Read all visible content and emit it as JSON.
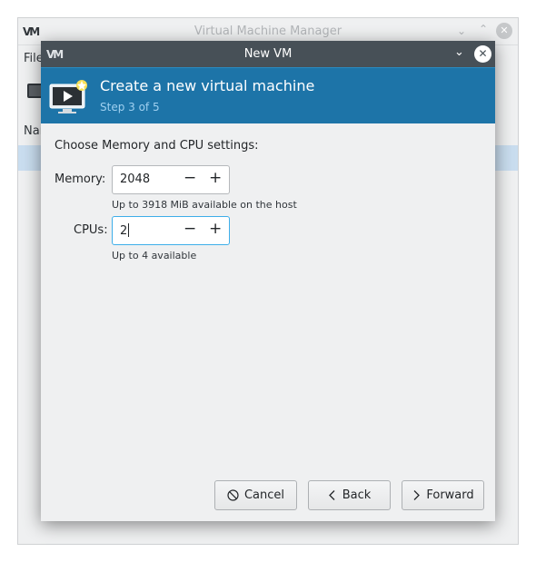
{
  "main_window": {
    "title": "Virtual Machine Manager",
    "logo": "VM",
    "menu_file": "File",
    "column_name": "Name"
  },
  "dialog": {
    "title": "New VM",
    "logo": "VM",
    "banner": {
      "title": "Create a new virtual machine",
      "step": "Step 3 of 5",
      "accent": "#1d74a8"
    },
    "section_label": "Choose Memory and CPU settings:",
    "memory": {
      "label": "Memory:",
      "value": "2048",
      "hint": "Up to 3918 MiB available on the host"
    },
    "cpus": {
      "label": "CPUs:",
      "value": "2",
      "hint": "Up to 4 available"
    },
    "buttons": {
      "cancel": "Cancel",
      "back": "Back",
      "forward": "Forward"
    },
    "icons": {
      "cancel": "cancel-icon",
      "back": "chevron-left-icon",
      "forward": "chevron-right-icon"
    }
  }
}
